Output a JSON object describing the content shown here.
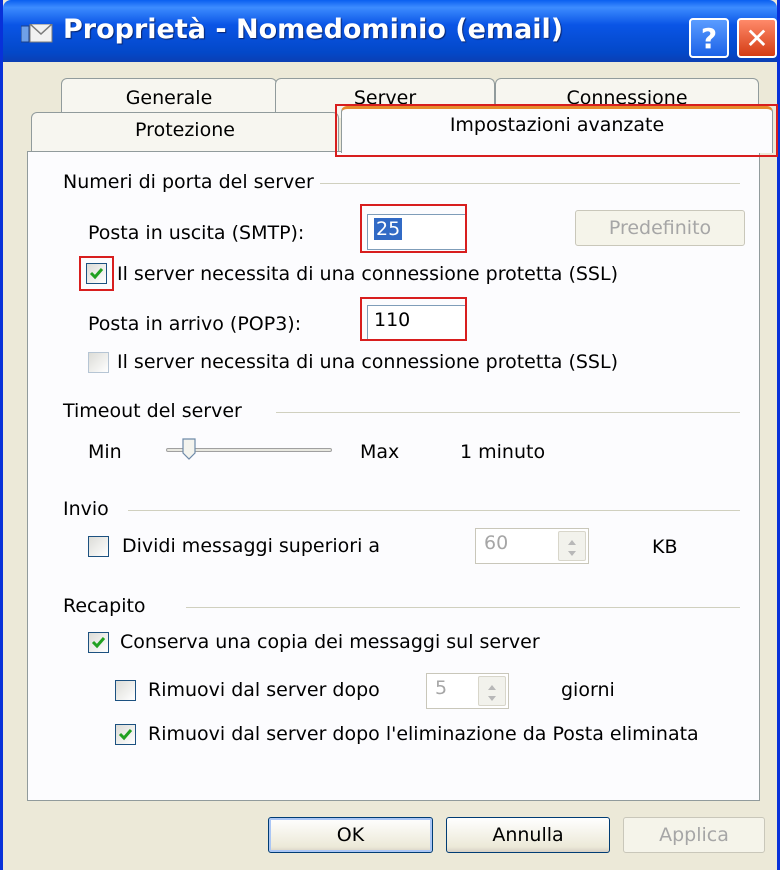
{
  "window": {
    "title": "Proprietà - Nomedominio (email)",
    "help_label": "?",
    "close_label": "✕"
  },
  "tabs": {
    "row1": [
      "Generale",
      "Server",
      "Connessione"
    ],
    "row2": [
      "Protezione",
      "Impostazioni avanzate"
    ],
    "active": "Impostazioni avanzate"
  },
  "ports": {
    "group_label": "Numeri di porta del server",
    "smtp_label": "Posta in uscita (SMTP):",
    "smtp_value": "25",
    "default_button": "Predefinito",
    "smtp_ssl_label": "Il server necessita di una connessione protetta (SSL)",
    "smtp_ssl_checked": true,
    "pop3_label": "Posta in arrivo (POP3):",
    "pop3_value": "110",
    "pop3_ssl_label": "Il server necessita di una connessione protetta (SSL)",
    "pop3_ssl_checked": false
  },
  "timeout": {
    "group_label": "Timeout del server",
    "min_label": "Min",
    "max_label": "Max",
    "value_label": "1 minuto"
  },
  "send": {
    "group_label": "Invio",
    "split_label": "Dividi messaggi superiori a",
    "split_checked": false,
    "split_value": "60",
    "unit": "KB"
  },
  "delivery": {
    "group_label": "Recapito",
    "keep_copy_label": "Conserva una copia dei messaggi sul server",
    "keep_copy_checked": true,
    "remove_after_label": "Rimuovi dal server dopo",
    "remove_after_checked": false,
    "remove_after_value": "5",
    "days_label": "giorni",
    "remove_deleted_label": "Rimuovi dal server dopo l'eliminazione da Posta eliminata",
    "remove_deleted_checked": true
  },
  "buttons": {
    "ok": "OK",
    "cancel": "Annulla",
    "apply": "Applica"
  },
  "colors": {
    "titlebar": "#0a55e6",
    "highlight_box": "#d81e1e",
    "check_mark": "#21a121"
  }
}
